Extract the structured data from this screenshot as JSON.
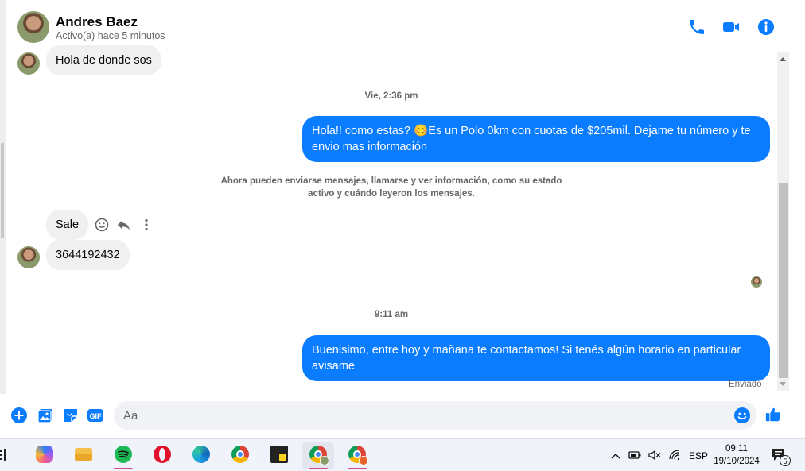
{
  "header": {
    "contact_name": "Andres Baez",
    "status": "Activo(a) hace 5 minutos",
    "icons": [
      "phone-icon",
      "video-call-icon",
      "info-icon"
    ],
    "accent": "#0a7cff"
  },
  "messages": {
    "msg1": "Hola de donde sos",
    "stamp1": "Vie, 2:36 pm",
    "msg2": "Hola!! como estas? 😊Es un Polo 0km con cuotas de $205mil. Dejame tu número y te envio mas información",
    "system_note": "Ahora pueden enviarse mensajes, llamarse y ver información, como su estado activo y cuándo leyeron los mensajes.",
    "msg3": "Sale",
    "msg4": "3644192432",
    "stamp2": "9:11 am",
    "msg5": "Buenisimo, entre hoy y mañana te contactamos! Si tenés algún horario en particular avisame",
    "delivery_status": "Enviado"
  },
  "composer": {
    "placeholder": "Aa",
    "icons": [
      "plus-icon",
      "photo-icon",
      "sticker-icon",
      "gif-icon",
      "emoji-icon",
      "like-icon"
    ],
    "gif_label": "GIF"
  },
  "taskbar": {
    "apps": [
      "copilot-icon",
      "file-explorer-icon",
      "spotify-icon",
      "opera-icon",
      "edge-icon",
      "chrome-icon",
      "sticky-notes-icon",
      "chrome-profile-icon",
      "chrome-profile-2-icon"
    ],
    "language": "ESP",
    "time": "09:11",
    "date": "19/10/2024",
    "notification_count": "5"
  }
}
